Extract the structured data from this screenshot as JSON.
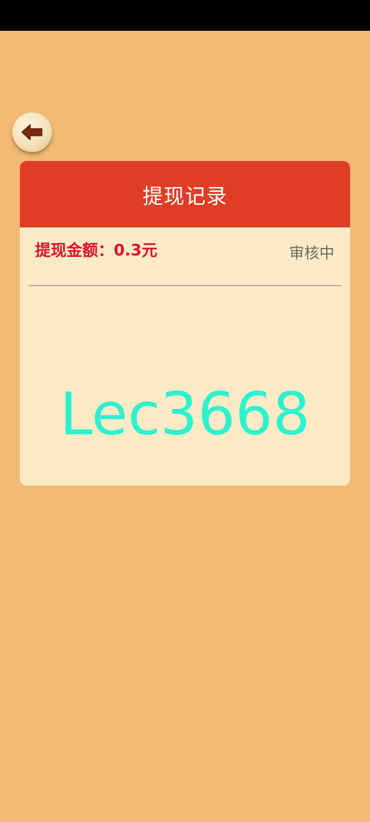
{
  "header": {
    "title": "提现记录"
  },
  "records": [
    {
      "amount_text": "提现金额：0.3元",
      "status": "审核中"
    }
  ],
  "watermark": "Lec3668",
  "icons": {
    "back": "back-arrow-icon"
  },
  "colors": {
    "background": "#f3ba76",
    "header": "#e03d25",
    "amount": "#e0112b",
    "watermark": "#2ef1cf"
  }
}
